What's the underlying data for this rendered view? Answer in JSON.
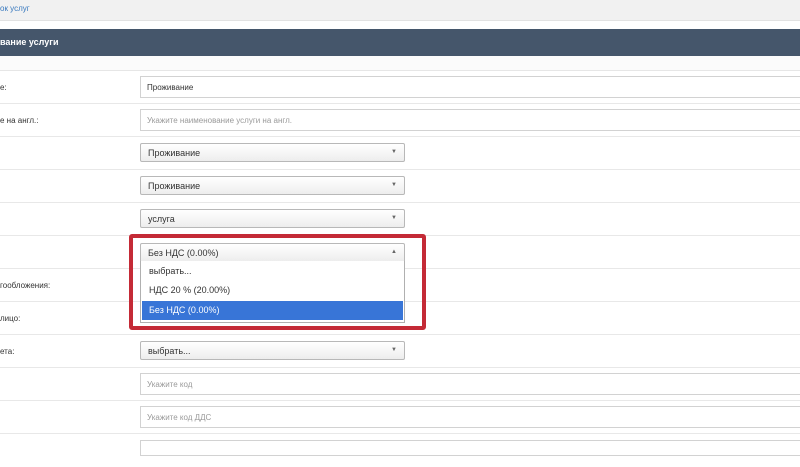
{
  "breadcrumb": "ок услуг",
  "panel": {
    "title": "вание услуги"
  },
  "rows": [
    {
      "label": "е:",
      "value": "Проживание",
      "placeholder": ""
    },
    {
      "label": "е на англ.:",
      "value": "",
      "placeholder": "Укажите наименование услуги на англ."
    },
    {
      "label": "",
      "value": "Проживание"
    },
    {
      "label": "",
      "value": "Проживание"
    },
    {
      "label": "",
      "value": "услуга"
    },
    {
      "label": "",
      "value": "Без НДС (0.00%)"
    },
    {
      "label": "гообложения:"
    },
    {
      "label": "лицо:"
    },
    {
      "label": "ета:",
      "value": "выбрать..."
    },
    {
      "label": "",
      "value": "",
      "placeholder": "Укажите код"
    },
    {
      "label": "",
      "value": "",
      "placeholder": "Укажите код ДДС"
    }
  ],
  "vat_dropdown": {
    "options": [
      "выбрать...",
      "НДС 20 % (20.00%)",
      "Без НДС (0.00%)"
    ],
    "selected": "Без НДС (0.00%)"
  },
  "icons": {
    "caret_down": "▼",
    "caret_up": "▲"
  },
  "colors": {
    "header": "#45566b",
    "highlight_border": "#c42a36",
    "selected_option": "#3875d7",
    "link": "#3a7abf"
  }
}
